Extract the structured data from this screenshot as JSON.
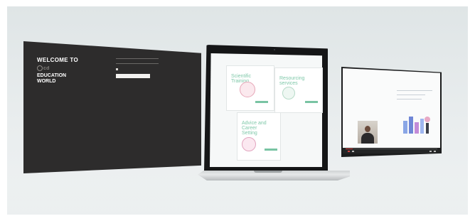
{
  "left_screen": {
    "welcome": "WELCOME TO",
    "logo": "© ▫",
    "world": "EDUCATION WORLD",
    "form_label_1": "",
    "form_label_2": "",
    "remember": "",
    "login_button": "",
    "link": ""
  },
  "laptop_screen": {
    "cards": [
      {
        "title": "Scientific Training"
      },
      {
        "title": "Resourcing services"
      },
      {
        "title": "Advice and Career Setting"
      }
    ]
  },
  "right_screen": {
    "title": "",
    "progress": 0.08
  },
  "colors": {
    "card_title": "#7fc8a9",
    "accent_bar": "#79c4a3",
    "left_screen_bg": "#2d2c2c",
    "progress": "#e04848"
  }
}
